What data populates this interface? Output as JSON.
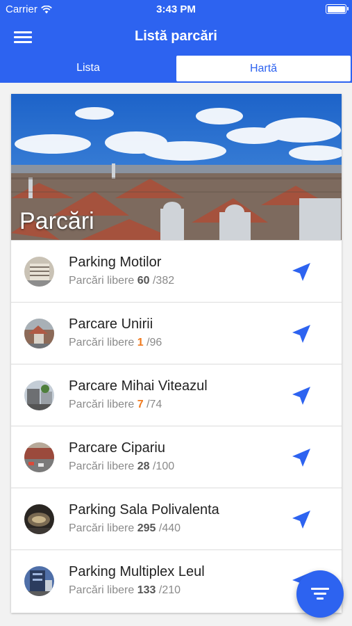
{
  "status_bar": {
    "carrier": "Carrier",
    "time": "3:43 PM"
  },
  "header": {
    "title": "Listă parcări",
    "menu_icon": "hamburger-menu-icon"
  },
  "tabs": [
    {
      "label": "Lista",
      "active": true
    },
    {
      "label": "Hartă",
      "active": false
    }
  ],
  "banner": {
    "title": "Parcări"
  },
  "parkings": [
    {
      "name": "Parking Motilor",
      "free_label": "Parcări libere",
      "free": "60",
      "total": "/382",
      "low": false
    },
    {
      "name": "Parcare Unirii",
      "free_label": "Parcări libere",
      "free": "1",
      "total": "/96",
      "low": true
    },
    {
      "name": "Parcare Mihai Viteazul",
      "free_label": "Parcări libere",
      "free": "7",
      "total": "/74",
      "low": true
    },
    {
      "name": "Parcare Cipariu",
      "free_label": "Parcări libere",
      "free": "28",
      "total": "/100",
      "low": false
    },
    {
      "name": "Parking Sala Polivalenta",
      "free_label": "Parcări libere",
      "free": "295",
      "total": "/440",
      "low": false
    },
    {
      "name": "Parking Multiplex Leul",
      "free_label": "Parcări libere",
      "free": "133",
      "total": "/210",
      "low": false
    }
  ],
  "colors": {
    "primary": "#2d63f0",
    "low_availability": "#f07a1e"
  },
  "icons": {
    "navigate": "navigate-arrow-icon",
    "filter": "filter-icon"
  }
}
